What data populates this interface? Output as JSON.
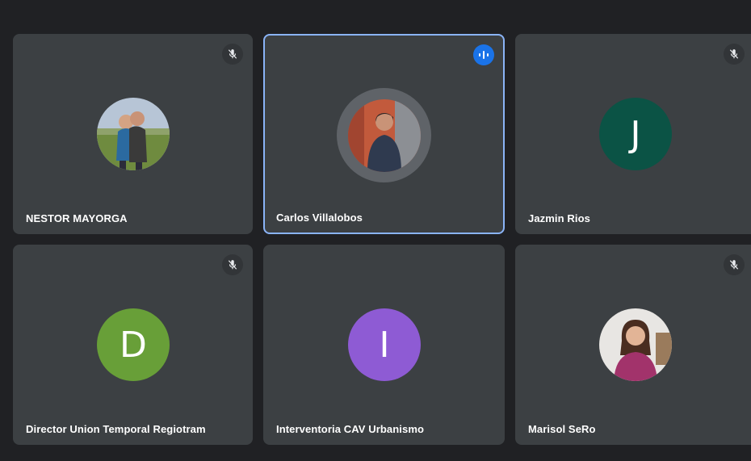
{
  "participants": [
    {
      "name": "NESTOR MAYORGA",
      "avatar_type": "photo",
      "avatar_icon": "couple-outdoor-photo",
      "muted": true,
      "speaking": false
    },
    {
      "name": "Carlos Villalobos",
      "avatar_type": "photo",
      "avatar_icon": "man-portrait-photo",
      "muted": false,
      "speaking": true
    },
    {
      "name": "Jazmin Rios",
      "avatar_type": "initial",
      "initial": "J",
      "avatar_color": "#0b5345",
      "muted": true,
      "speaking": false
    },
    {
      "name": "Director Union Temporal Regiotram",
      "avatar_type": "initial",
      "initial": "D",
      "avatar_color": "#689f38",
      "muted": true,
      "speaking": false
    },
    {
      "name": "Interventoria CAV Urbanismo",
      "avatar_type": "initial",
      "initial": "I",
      "avatar_color": "#8e5bd4",
      "muted": false,
      "speaking": false
    },
    {
      "name": "Marisol SeRo",
      "avatar_type": "photo",
      "avatar_icon": "woman-portrait-photo",
      "muted": true,
      "speaking": false
    }
  ],
  "colors": {
    "background": "#202124",
    "tile": "#3c4043",
    "speaking_border": "#8ab4f8",
    "speaking_indicator": "#1a73e8"
  }
}
